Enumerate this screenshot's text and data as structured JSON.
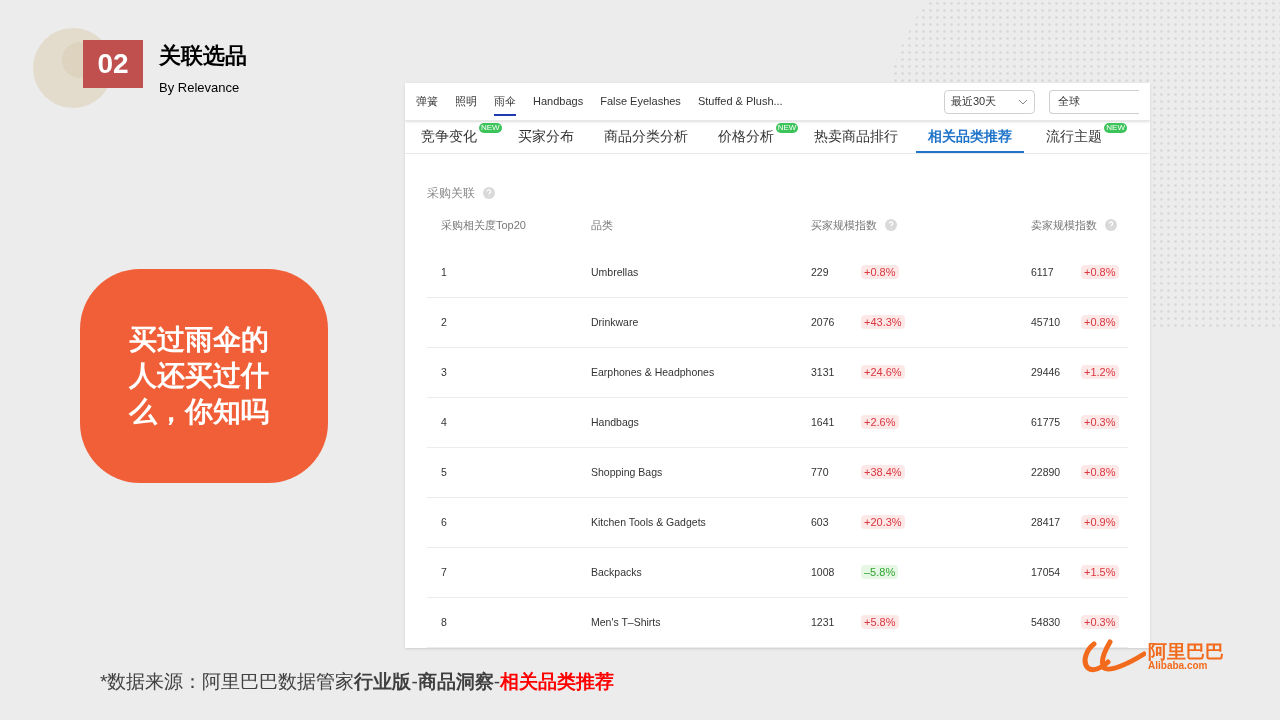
{
  "section": {
    "number": "02",
    "title": "关联选品",
    "subtitle": "By Relevance"
  },
  "callout": "买过雨伞的人还买过什么，你知吗",
  "screenshot": {
    "category_tabs": [
      {
        "label": "弹簧",
        "selected": false
      },
      {
        "label": "照明",
        "selected": false
      },
      {
        "label": "雨伞",
        "selected": true
      },
      {
        "label": "Handbags",
        "selected": false
      },
      {
        "label": "False Eyelashes",
        "selected": false
      },
      {
        "label": "Stuffed & Plush...",
        "selected": false
      }
    ],
    "period_select": "最近30天",
    "region_select": "全球",
    "tabs": [
      {
        "label": "竞争变化",
        "badge": "NEW",
        "selected": false
      },
      {
        "label": "买家分布",
        "selected": false
      },
      {
        "label": "商品分类分析",
        "selected": false
      },
      {
        "label": "价格分析",
        "badge": "NEW",
        "selected": false
      },
      {
        "label": "热卖商品排行",
        "selected": false
      },
      {
        "label": "相关品类推荐",
        "selected": true
      },
      {
        "label": "流行主题",
        "badge": "NEW",
        "selected": false
      }
    ],
    "section_title": "采购关联",
    "table": {
      "columns": [
        "采购相关度Top20",
        "品类",
        "买家规模指数",
        "卖家规模指数"
      ],
      "rows": [
        {
          "rank": "1",
          "category": "Umbrellas",
          "buyers": "229",
          "buyers_change": "+0.8%",
          "buyers_negative": false,
          "sellers": "6117",
          "sellers_change": "+0.8%",
          "sellers_negative": false
        },
        {
          "rank": "2",
          "category": "Drinkware",
          "buyers": "2076",
          "buyers_change": "+43.3%",
          "buyers_negative": false,
          "sellers": "45710",
          "sellers_change": "+0.8%",
          "sellers_negative": false
        },
        {
          "rank": "3",
          "category": "Earphones & Headphones",
          "buyers": "3131",
          "buyers_change": "+24.6%",
          "buyers_negative": false,
          "sellers": "29446",
          "sellers_change": "+1.2%",
          "sellers_negative": false
        },
        {
          "rank": "4",
          "category": "Handbags",
          "buyers": "1641",
          "buyers_change": "+2.6%",
          "buyers_negative": false,
          "sellers": "61775",
          "sellers_change": "+0.3%",
          "sellers_negative": false
        },
        {
          "rank": "5",
          "category": "Shopping Bags",
          "buyers": "770",
          "buyers_change": "+38.4%",
          "buyers_negative": false,
          "sellers": "22890",
          "sellers_change": "+0.8%",
          "sellers_negative": false
        },
        {
          "rank": "6",
          "category": "Kitchen Tools & Gadgets",
          "buyers": "603",
          "buyers_change": "+20.3%",
          "buyers_negative": false,
          "sellers": "28417",
          "sellers_change": "+0.9%",
          "sellers_negative": false
        },
        {
          "rank": "7",
          "category": "Backpacks",
          "buyers": "1008",
          "buyers_change": "–5.8%",
          "buyers_negative": true,
          "sellers": "17054",
          "sellers_change": "+1.5%",
          "sellers_negative": false
        },
        {
          "rank": "8",
          "category": "Men's T–Shirts",
          "buyers": "1231",
          "buyers_change": "+5.8%",
          "buyers_negative": false,
          "sellers": "54830",
          "sellers_change": "+0.3%",
          "sellers_negative": false
        }
      ]
    }
  },
  "source": [
    {
      "text": "*数据来源：阿里巴巴数据管家",
      "kind": "normal"
    },
    {
      "text": "行业版",
      "kind": "bold"
    },
    {
      "text": "-",
      "kind": "normal"
    },
    {
      "text": "商品洞察",
      "kind": "bold"
    },
    {
      "text": "-",
      "kind": "normal"
    },
    {
      "text": "相关品类推荐",
      "kind": "highlight"
    }
  ],
  "logo": {
    "name": "阿里巴巴",
    "domain": "Alibaba.com"
  }
}
